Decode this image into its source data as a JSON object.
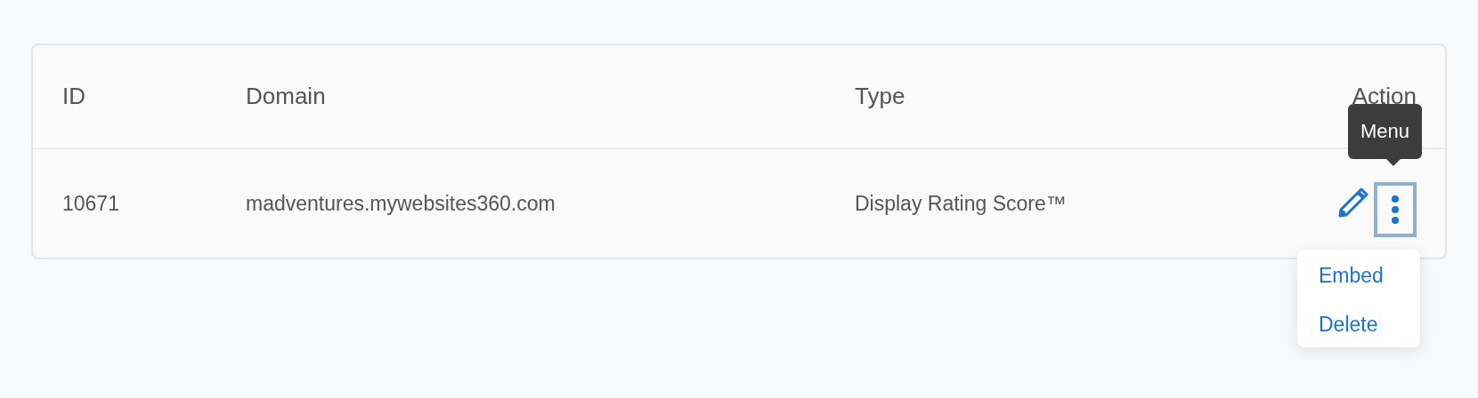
{
  "table": {
    "columns": [
      "ID",
      "Domain",
      "Type",
      "Action"
    ],
    "rows": [
      {
        "id": "10671",
        "domain": "madventures.mywebsites360.com",
        "type": "Display Rating Score™"
      }
    ]
  },
  "tooltip": {
    "text": "Menu"
  },
  "menu": {
    "items": [
      "Embed",
      "Delete"
    ]
  }
}
